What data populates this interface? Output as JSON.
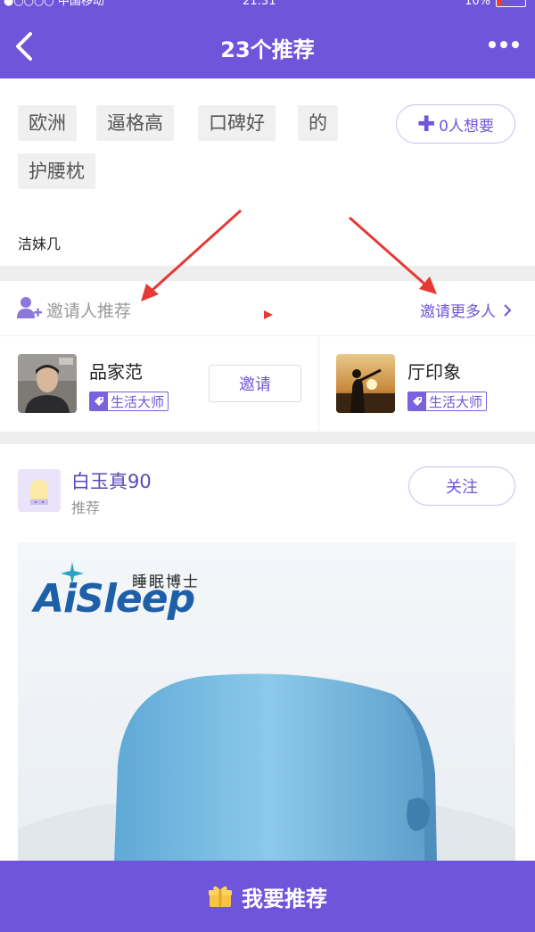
{
  "status_bar": {
    "carrier": "●○○○○ 中国移动",
    "time": "21:31",
    "battery": "10%"
  },
  "header": {
    "title": "23个推荐"
  },
  "tags": [
    "欧洲",
    "逼格高",
    "口碑好",
    "的",
    "护腰枕"
  ],
  "want_button": {
    "label": "0人想要"
  },
  "author": "洁妹几",
  "invite_section": {
    "label": "邀请人推荐",
    "more_label": "邀请更多人",
    "users": [
      {
        "name": "品家范",
        "badge": "生活大师",
        "action": "邀请"
      },
      {
        "name": "厅印象",
        "badge": "生活大师"
      }
    ]
  },
  "recommendation": {
    "user_name": "白玉真90",
    "subtitle": "推荐",
    "follow_label": "关注",
    "brand_logo": "AiSleep",
    "brand_cn": "睡眠博士"
  },
  "bottom_button": {
    "label": "我要推荐"
  },
  "colors": {
    "primary": "#6f55d9",
    "annotation_arrow": "#e53935"
  }
}
